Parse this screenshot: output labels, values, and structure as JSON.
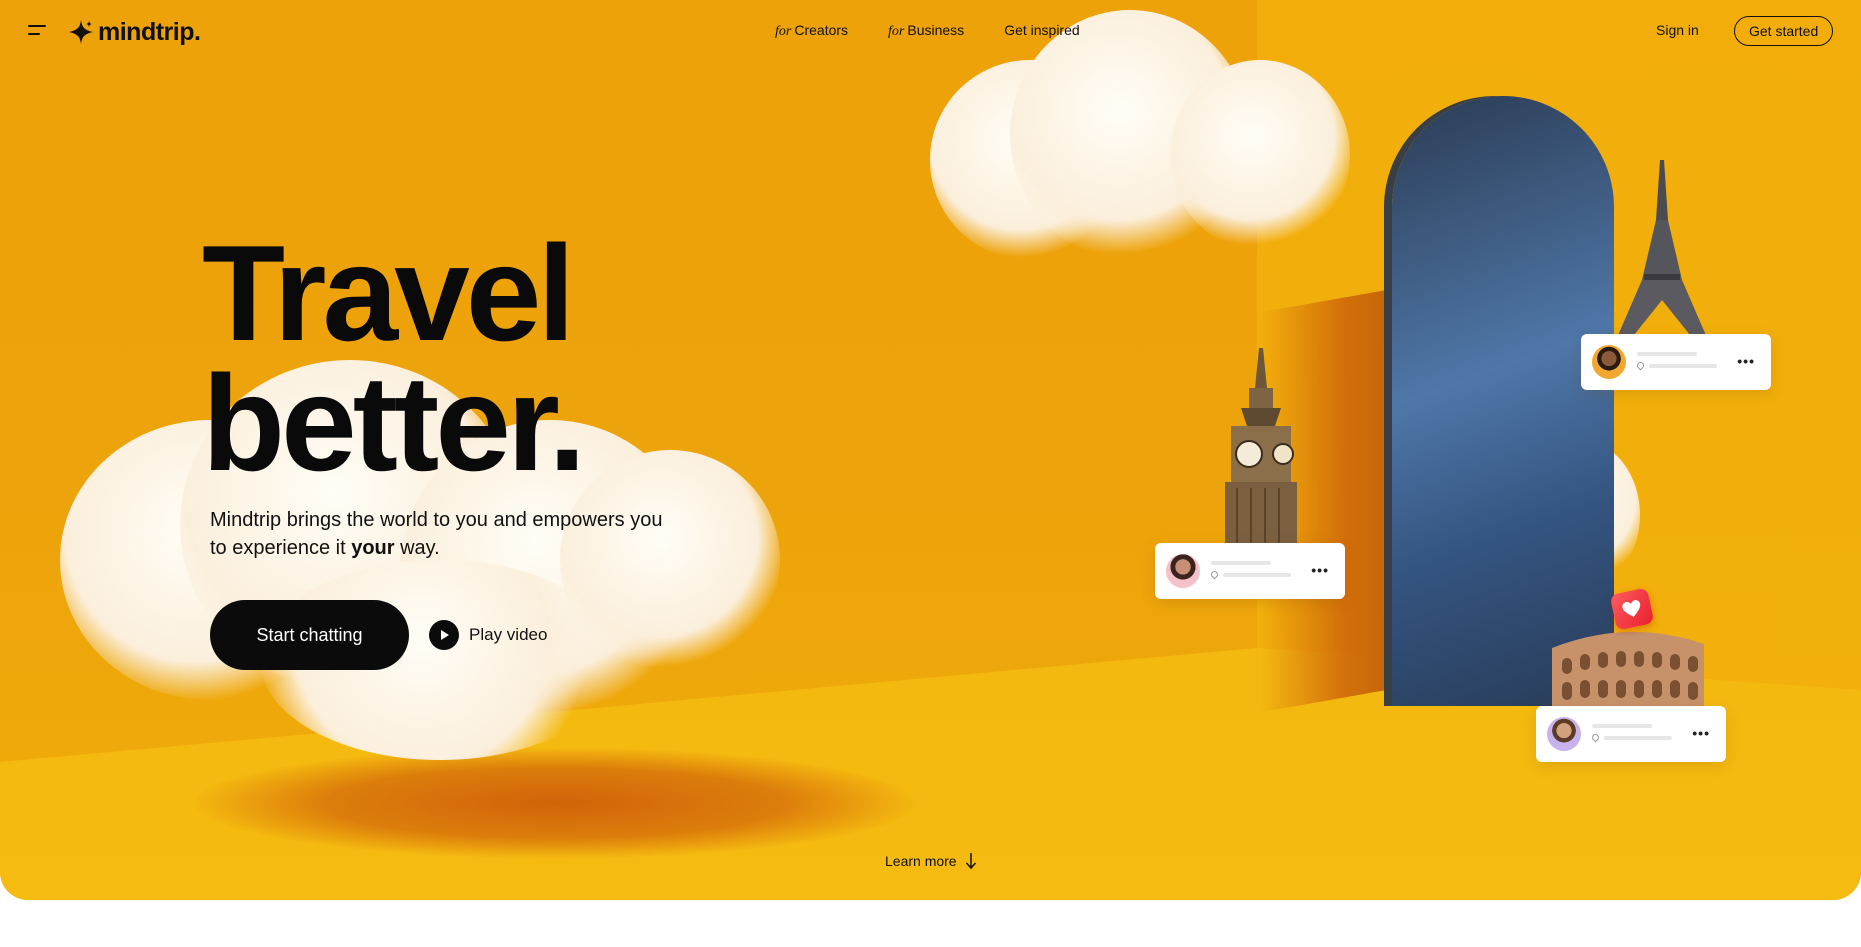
{
  "nav": {
    "brand": "mindtrip.",
    "links": [
      {
        "prefix": "for",
        "label": "Creators"
      },
      {
        "prefix": "for",
        "label": "Business"
      },
      {
        "prefix": "",
        "label": "Get inspired"
      }
    ],
    "sign_in": "Sign in",
    "get_started": "Get started"
  },
  "hero": {
    "headline_line1": "Travel",
    "headline_line2": "better.",
    "subtitle_part1": "Mindtrip brings the world to you and empowers you to experience it ",
    "subtitle_bold": "your",
    "subtitle_part2": " way.",
    "start_chatting": "Start chatting",
    "play_video": "Play video",
    "learn_more": "Learn more"
  },
  "icons": {
    "menu": "menu-icon",
    "logo": "sparkle-icon",
    "play": "play-icon",
    "arrow": "arrow-down-icon",
    "more": "more-dots-icon",
    "heart": "heart-icon",
    "pin": "location-pin-icon"
  },
  "colors": {
    "hero_bg": "#eea20a",
    "floor": "#f4b80e",
    "text": "#0a0a0a",
    "button_bg": "#0b0b0b",
    "heart": "#e8202e",
    "arch": "#4f77a8"
  }
}
